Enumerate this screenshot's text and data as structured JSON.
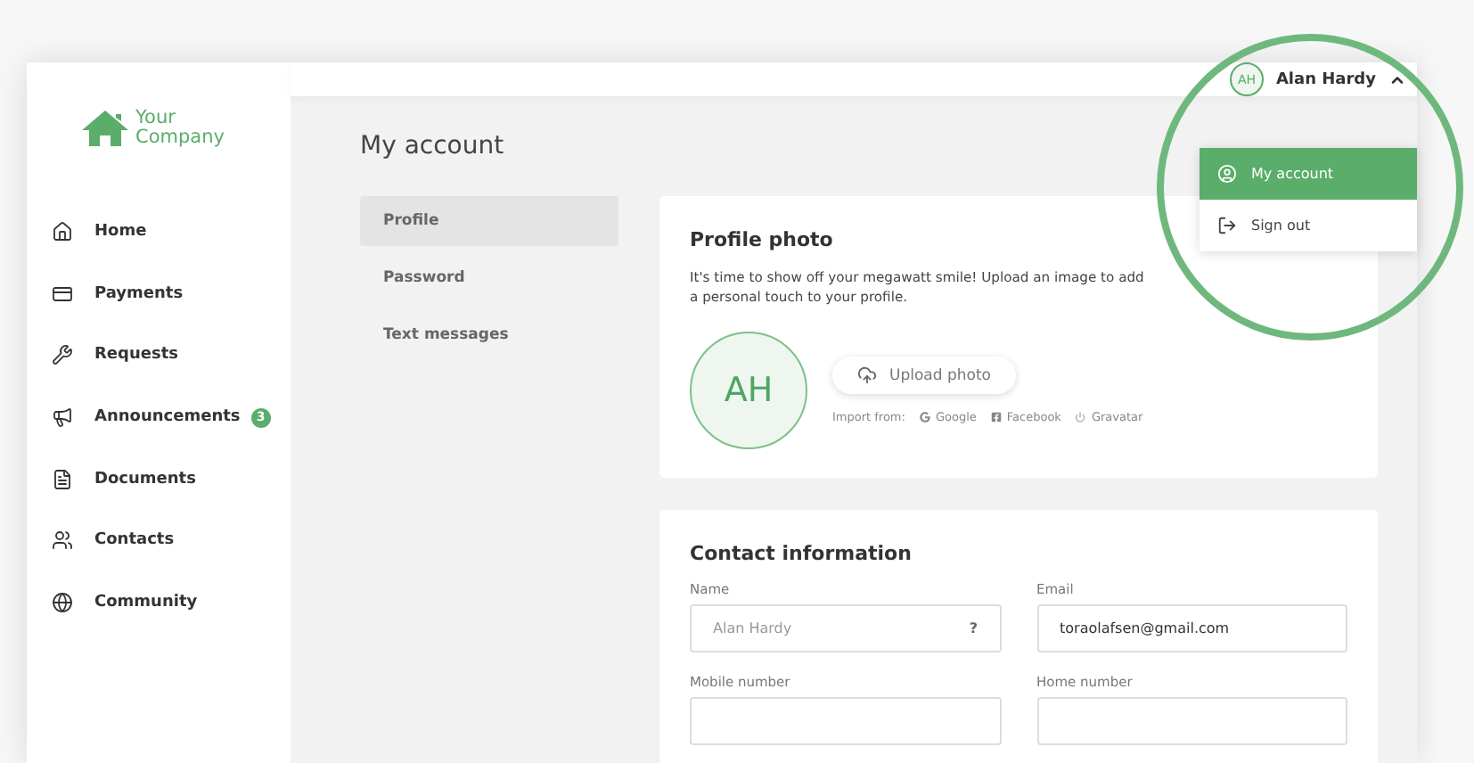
{
  "logo": {
    "line_1": "Your",
    "line_2": "Company"
  },
  "sidebar": {
    "items": [
      {
        "label": "Home"
      },
      {
        "label": "Payments"
      },
      {
        "label": "Requests"
      },
      {
        "label": "Announcements",
        "badge": "3"
      },
      {
        "label": "Documents"
      },
      {
        "label": "Contacts"
      },
      {
        "label": "Community"
      }
    ]
  },
  "header": {
    "initials": "AH",
    "user_name": "Alan Hardy",
    "menu_expanded": true
  },
  "user_menu": [
    {
      "label": "My account",
      "selected": true
    },
    {
      "label": "Sign out",
      "selected": false
    }
  ],
  "page_title": "My account",
  "tabs": [
    {
      "label": "Profile",
      "selected": true
    },
    {
      "label": "Password",
      "selected": false
    },
    {
      "label": "Text messages",
      "selected": false
    }
  ],
  "profile_photo": {
    "title": "Profile photo",
    "description": "It's time to show off your megawatt smile! Upload an image to add a personal touch to your profile.",
    "initials": "AH",
    "upload_button": "Upload photo",
    "import_label": "Import from:",
    "sources": [
      {
        "label": "Google"
      },
      {
        "label": "Facebook"
      },
      {
        "label": "Gravatar"
      }
    ]
  },
  "contact_information": {
    "title": "Contact information",
    "fields": [
      {
        "label": "Name",
        "value": "Alan Hardy",
        "disabled": true,
        "help": "?"
      },
      {
        "label": "Email",
        "value": "toraolafsen@gmail.com",
        "disabled": false
      },
      {
        "label": "Mobile number"
      },
      {
        "label": "Home number"
      }
    ]
  }
}
